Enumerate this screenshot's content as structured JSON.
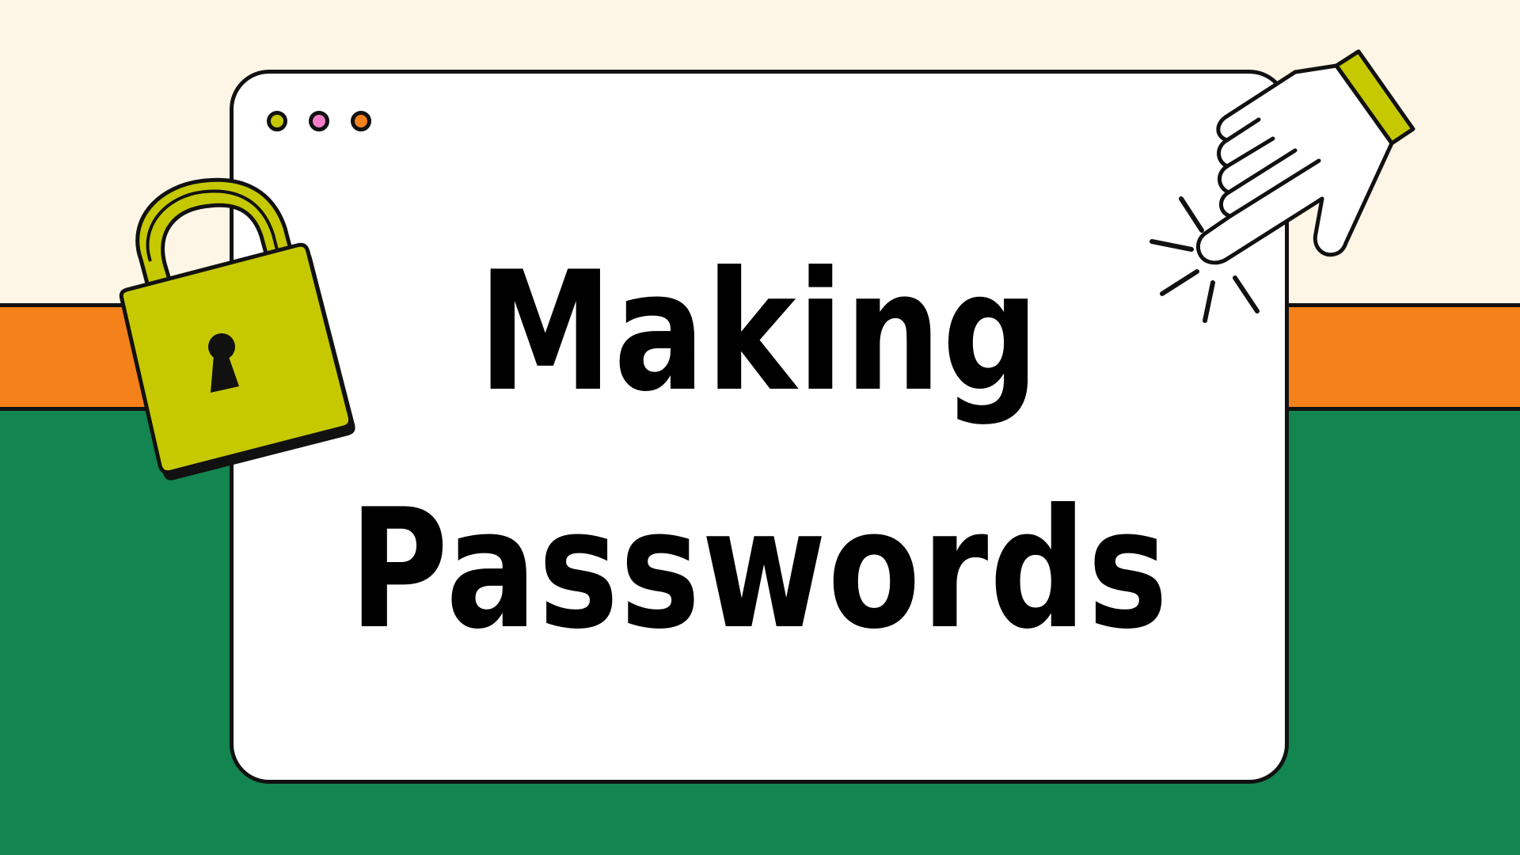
{
  "title": {
    "line1": "Making",
    "line2": "Passwords"
  },
  "colors": {
    "background_top": "#FDF6E6",
    "stripe_orange": "#F48119",
    "background_green": "#138550",
    "window_fill": "#FFFFFF",
    "outline": "#111111",
    "lock_yellow": "#C6C900",
    "dot_yellow": "#C6C900",
    "dot_pink": "#F57CC8",
    "dot_orange": "#F48119"
  },
  "window": {
    "dots": [
      "yellow-dot",
      "pink-dot",
      "orange-dot"
    ]
  },
  "icons": {
    "lock": "padlock-icon",
    "hand": "pointing-hand-icon"
  }
}
